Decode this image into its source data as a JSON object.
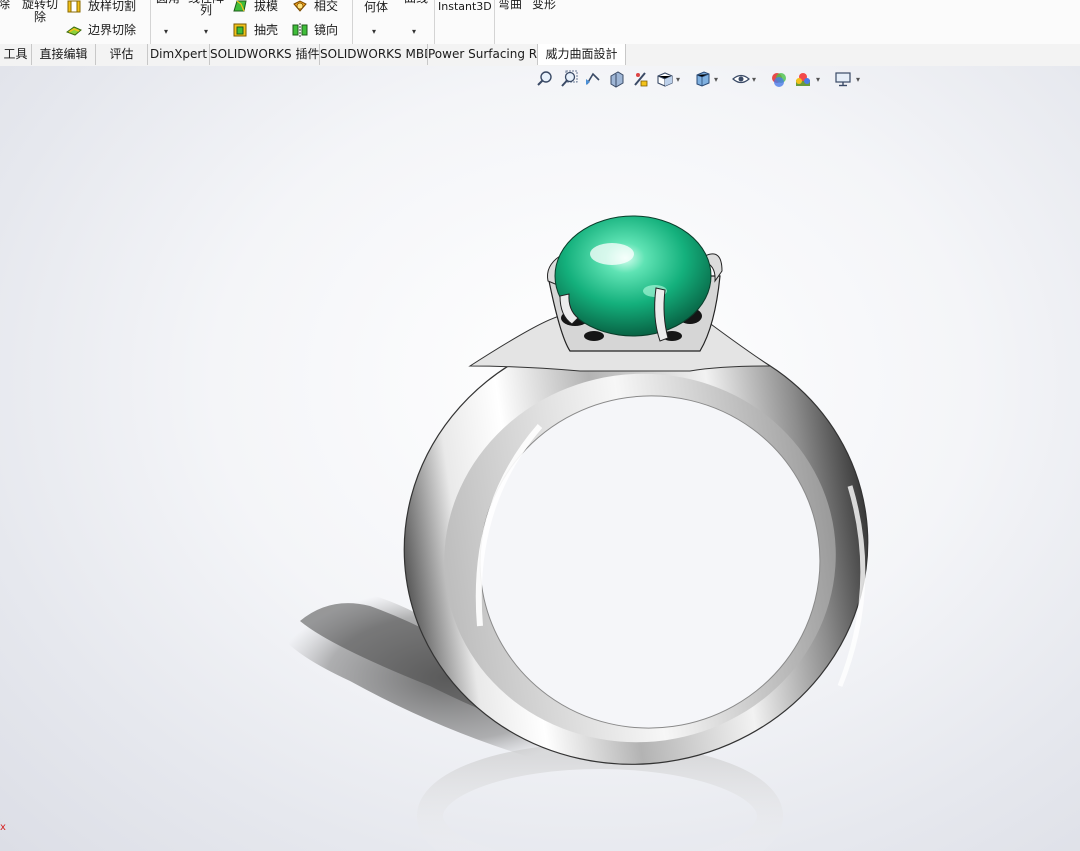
{
  "ribbon": {
    "group1": {
      "truncated_left_label": "拉伸切除",
      "rotate_cut_label": "旋转切除",
      "loft_cut_label": "放样切割",
      "boundary_cut_label": "边界切除"
    },
    "group2": {
      "fillet_label": "圆角",
      "linear_pattern_label": "线性阵列",
      "draft_label": "拔模",
      "shell_label": "抽壳",
      "intersect_label": "相交",
      "mirror_label": "镜向"
    },
    "group3": {
      "reference_geometry_label": "参考几何体",
      "curves_label": "曲线"
    },
    "group4": {
      "instant3d_label": "Instant3D"
    },
    "group5": {
      "flex_label": "弯曲",
      "deform_label": "变形"
    }
  },
  "tabs": [
    {
      "label": "工具",
      "active": false
    },
    {
      "label": "直接编辑",
      "active": false
    },
    {
      "label": "评估",
      "active": false
    },
    {
      "label": "DimXpert",
      "active": false
    },
    {
      "label": "SOLIDWORKS 插件",
      "active": false
    },
    {
      "label": "SOLIDWORKS MBD",
      "active": false
    },
    {
      "label": "Power Surfacing RE",
      "active": false
    },
    {
      "label": "威力曲面設計",
      "active": true
    }
  ],
  "heads_up_toolbar": {
    "icons": [
      "zoom-to-fit-icon",
      "zoom-to-area-icon",
      "previous-view-icon",
      "section-view-icon",
      "dynamic-annotation-icon",
      "view-orientation-icon",
      "display-style-icon",
      "hide-show-items-icon",
      "edit-appearance-icon",
      "apply-scene-icon",
      "view-settings-icon"
    ]
  },
  "model": {
    "name": "ring-model",
    "gem_color": "#19b27e",
    "metal_color": "#d9d9d9"
  },
  "colors": {
    "ribbon_bg": "#fbfbfb",
    "tab_bg": "#f3f3f3",
    "viewport_center": "#ffffff",
    "viewport_edge": "#dcdee6",
    "triad_x": "#d42020"
  },
  "status": {
    "triad_label": "x"
  }
}
